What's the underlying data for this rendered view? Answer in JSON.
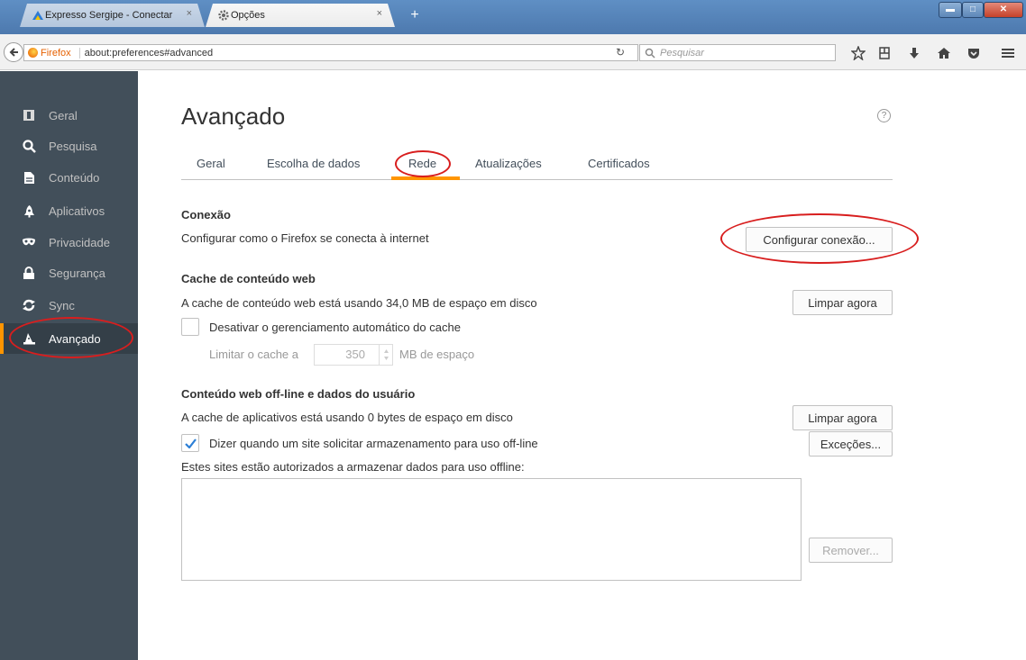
{
  "browser": {
    "tabs": [
      {
        "label": "Expresso Sergipe - Conectar",
        "close": "×"
      },
      {
        "label": "Opções",
        "close": "×"
      }
    ],
    "new_tab": "+",
    "url_brand": "Firefox",
    "url": "about:preferences#advanced",
    "search_placeholder": "Pesquisar"
  },
  "sidebar": {
    "items": [
      {
        "label": "Geral",
        "icon": "general-icon"
      },
      {
        "label": "Pesquisa",
        "icon": "search-icon"
      },
      {
        "label": "Conteúdo",
        "icon": "document-icon"
      },
      {
        "label": "Aplicativos",
        "icon": "rocket-icon"
      },
      {
        "label": "Privacidade",
        "icon": "mask-icon"
      },
      {
        "label": "Segurança",
        "icon": "lock-icon"
      },
      {
        "label": "Sync",
        "icon": "sync-icon"
      },
      {
        "label": "Avançado",
        "icon": "wizard-hat-icon",
        "selected": true
      }
    ]
  },
  "main": {
    "title": "Avançado",
    "help": "?",
    "tabs": [
      "Geral",
      "Escolha de dados",
      "Rede",
      "Atualizações",
      "Certificados"
    ],
    "selected_tab": "Rede",
    "connection": {
      "heading": "Conexão",
      "description": "Configurar como o Firefox se conecta à internet",
      "button": "Configurar conexão..."
    },
    "cache": {
      "heading": "Cache de conteúdo web",
      "usage": "A cache de conteúdo web está usando 34,0 MB de espaço em disco",
      "clear_button": "Limpar agora",
      "override_label": "Desativar o gerenciamento automático do cache",
      "override_checked": false,
      "limit_prefix": "Limitar o cache a",
      "limit_value": "350",
      "limit_suffix": "MB de espaço"
    },
    "offline": {
      "heading": "Conteúdo web off-line e dados do usuário",
      "usage": "A cache de aplicativos está usando 0 bytes de espaço em disco",
      "clear_button": "Limpar agora",
      "notify_label": "Dizer quando um site solicitar armazenamento para uso off-line",
      "notify_checked": true,
      "exceptions_button": "Exceções...",
      "list_label": "Estes sites estão autorizados a armazenar dados para uso offline:",
      "remove_button": "Remover..."
    }
  },
  "colors": {
    "accent": "#ff9500",
    "sidebar": "#424f5a",
    "annotation": "#d81e1e"
  }
}
